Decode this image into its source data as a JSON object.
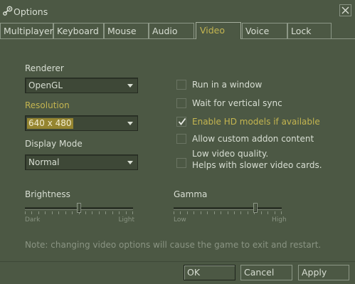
{
  "window": {
    "title": "Options",
    "colors": {
      "background": "#4c5844",
      "text": "#d8ded3",
      "accent": "#c4b550",
      "muted": "#8a9483",
      "selection": "#958530"
    }
  },
  "tabs": [
    {
      "label": "Multiplayer",
      "active": false
    },
    {
      "label": "Keyboard",
      "active": false
    },
    {
      "label": "Mouse",
      "active": false
    },
    {
      "label": "Audio",
      "active": false
    },
    {
      "label": "Video",
      "active": true
    },
    {
      "label": "Voice",
      "active": false
    },
    {
      "label": "Lock",
      "active": false
    }
  ],
  "video": {
    "renderer": {
      "label": "Renderer",
      "value": "OpenGL"
    },
    "resolution": {
      "label": "Resolution",
      "value": "640 x 480"
    },
    "display_mode": {
      "label": "Display Mode",
      "value": "Normal"
    },
    "options": [
      {
        "label": "Run in a window",
        "checked": false,
        "highlight": false
      },
      {
        "label": "Wait for vertical sync",
        "checked": false,
        "highlight": false
      },
      {
        "label": "Enable HD models if available",
        "checked": true,
        "highlight": true
      },
      {
        "label": "Allow custom addon content",
        "checked": false,
        "highlight": false
      },
      {
        "label_line1": "Low video quality.",
        "label_line2": "Helps with slower video cards.",
        "checked": false,
        "highlight": false
      }
    ],
    "brightness": {
      "label": "Brightness",
      "min_label": "Dark",
      "max_label": "Light",
      "level": 0.5
    },
    "gamma": {
      "label": "Gamma",
      "min_label": "Low",
      "max_label": "High",
      "level": 0.77
    },
    "note": "Note: changing video options will cause the game to exit and restart."
  },
  "buttons": {
    "ok": "OK",
    "cancel": "Cancel",
    "apply": "Apply"
  }
}
